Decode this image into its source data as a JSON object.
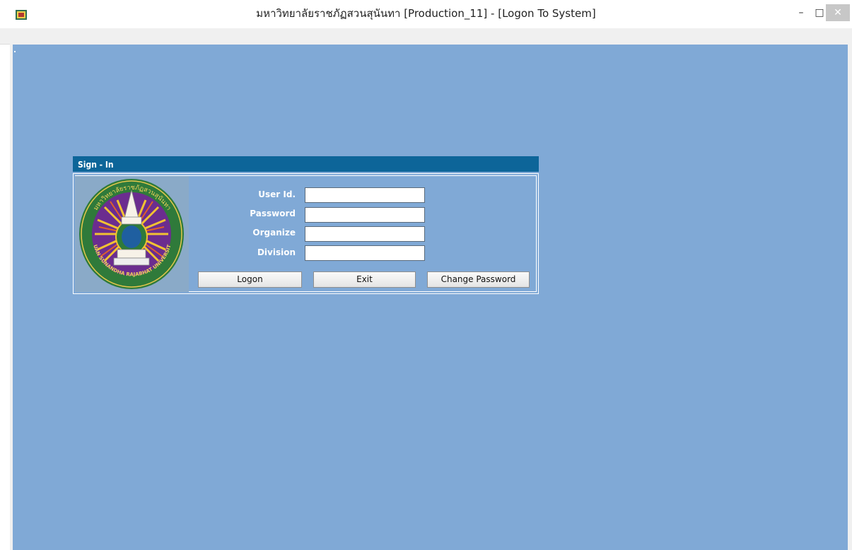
{
  "window": {
    "title": "มหาวิทยาลัยราชภัฏสวนสุนันทา  [Production_11] - [Logon To System]",
    "minimize_glyph": "–",
    "maximize_glyph": "□",
    "close_glyph": "✕"
  },
  "colors": {
    "canvas": "#80a9d6",
    "header": "#0d6599",
    "seal_purple": "#6b2d8f",
    "seal_green": "#2f7a3a",
    "seal_gold": "#f1c232"
  },
  "signin": {
    "header": "Sign - In",
    "fields": [
      {
        "label": "User Id.",
        "value": ""
      },
      {
        "label": "Password",
        "value": ""
      },
      {
        "label": "Organize",
        "value": ""
      },
      {
        "label": "Division",
        "value": ""
      }
    ],
    "buttons": {
      "logon": "Logon",
      "exit": "Exit",
      "change_password": "Change Password"
    }
  },
  "seal": {
    "text_top": "มหาวิทยาลัยราชภัฏสวนสุนันทา",
    "text_bottom": "SUAN SUNANDHA RAJABHAT UNIVERSITY"
  }
}
